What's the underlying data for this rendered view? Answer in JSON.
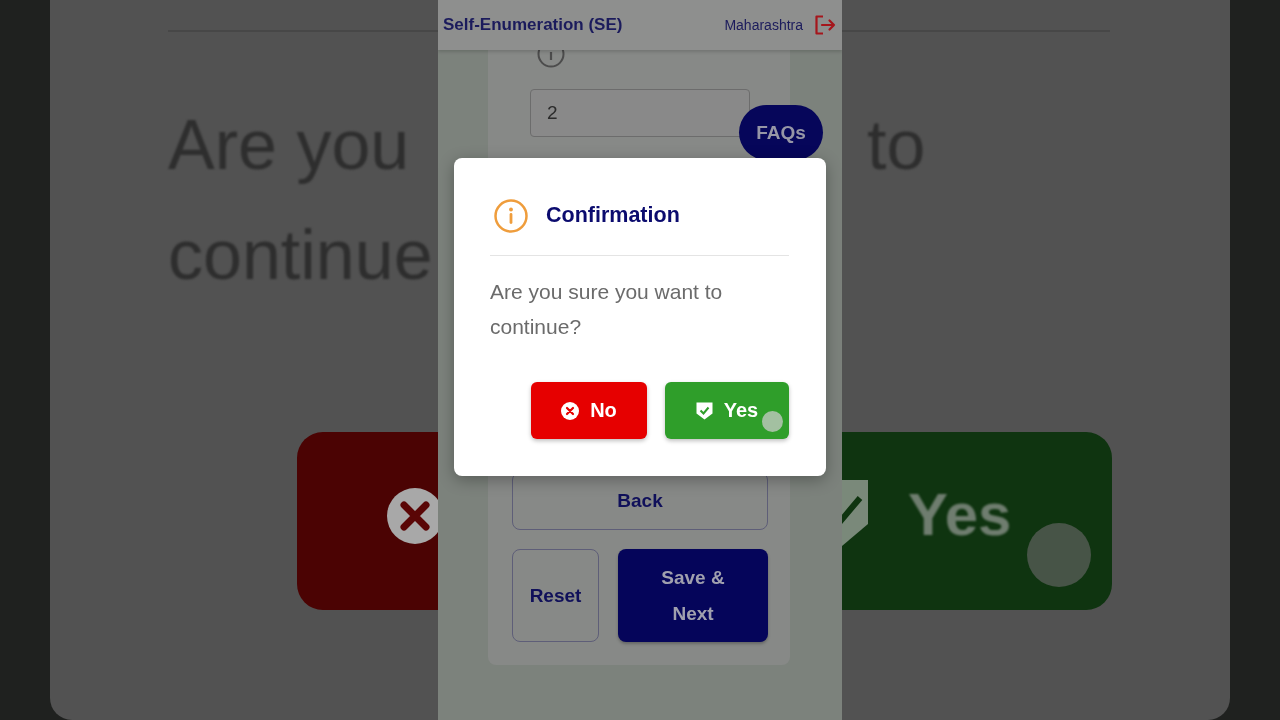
{
  "backdrop": {
    "left_lines": [
      "Are you",
      "continue"
    ],
    "left_button": {
      "kind": "cancel"
    },
    "right_lines": [
      "to"
    ],
    "right_button": {
      "kind": "confirm",
      "label": "Yes",
      "touched": true
    }
  },
  "header": {
    "title": "Self-Enumeration (SE)",
    "region": "Maharashtra"
  },
  "form": {
    "field": {
      "value": "2"
    },
    "faq_button": {
      "label": "FAQs"
    },
    "button_rows": [
      [
        {
          "label": "Back",
          "kind": "outline"
        }
      ],
      [
        {
          "label": "Reset",
          "kind": "outline"
        },
        {
          "label": "Save & Next",
          "kind": "filled"
        }
      ]
    ]
  },
  "dialog": {
    "title": "Confirmation",
    "message": "Are you sure you want to continue?",
    "buttons": [
      {
        "label": "No",
        "kind": "cancel",
        "touched": false
      },
      {
        "label": "Yes",
        "kind": "confirm",
        "touched": true
      }
    ]
  }
}
